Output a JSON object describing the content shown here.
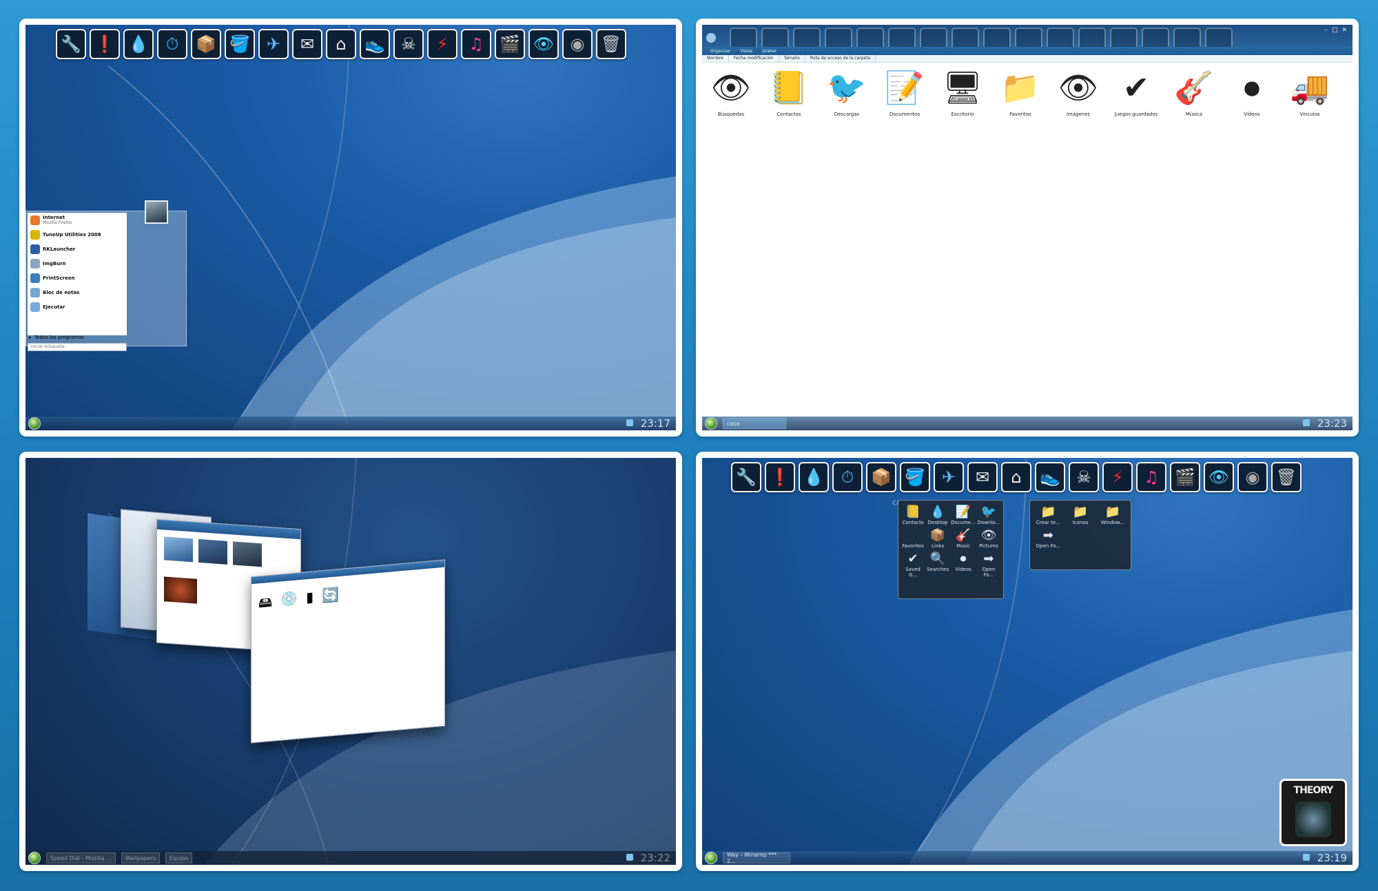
{
  "dock_icons": [
    "wrench-icon",
    "speech-bubble-icon",
    "drop-icon",
    "clock-icon",
    "box-icon",
    "paint-bucket-icon",
    "airplane-icon",
    "mail-icon",
    "home-icon",
    "runner-shoe-icon",
    "skull-icon",
    "lightning-icon",
    "music-note-icon",
    "clapperboard-icon",
    "eye-icon",
    "camera-lens-icon",
    "trash-icon"
  ],
  "panel1": {
    "clock": "23:17",
    "start_menu": {
      "items": [
        {
          "label": "Internet",
          "sub": "Mozilla Firefox",
          "icon": "firefox-icon"
        },
        {
          "label": "TuneUp Utilities 2008",
          "sub": "",
          "icon": "tuneup-icon"
        },
        {
          "label": "RKLauncher",
          "sub": "",
          "icon": "rklauncher-icon"
        },
        {
          "label": "ImgBurn",
          "sub": "",
          "icon": "imgburn-icon"
        },
        {
          "label": "PrintScreen",
          "sub": "",
          "icon": "printscreen-icon"
        },
        {
          "label": "Bloc de notas",
          "sub": "",
          "icon": "notepad-icon"
        },
        {
          "label": "Ejecutar",
          "sub": "",
          "icon": "run-icon"
        }
      ],
      "all_programs": "Todos los programas",
      "search_placeholder": "Iniciar búsqueda"
    }
  },
  "panel2": {
    "clock": "23:23",
    "toolbar": [
      "Organizar",
      "Vistas",
      "Grabar"
    ],
    "columns": [
      "Nombre",
      "Fecha modificación",
      "Tamaño",
      "Ruta de acceso de la carpeta"
    ],
    "folders": [
      {
        "label": "Búsquedas",
        "icon": "eyeball-icon"
      },
      {
        "label": "Contactos",
        "icon": "address-book-icon"
      },
      {
        "label": "Descargas",
        "icon": "bird-icon"
      },
      {
        "label": "Documentos",
        "icon": "pencil-paper-icon"
      },
      {
        "label": "Escritorio",
        "icon": "finder-icon"
      },
      {
        "label": "Favoritos",
        "icon": "apple-icon"
      },
      {
        "label": "Imágenes",
        "icon": "eye-icon"
      },
      {
        "label": "Juegos guardados",
        "icon": "checkmark-icon"
      },
      {
        "label": "Música",
        "icon": "guitar-icon"
      },
      {
        "label": "Vídeos",
        "icon": "quicktime-icon"
      },
      {
        "label": "Vínculos",
        "icon": "truck-icon"
      }
    ],
    "task": "casa"
  },
  "panel3": {
    "clock": "23:22",
    "tasks": [
      "Speed Dial - Mozilla ...",
      "Wallpapers",
      "Equipo"
    ]
  },
  "panel4": {
    "clock": "23:19",
    "fan_label": "casa",
    "fan1": [
      "Contacts",
      "Desktop",
      "Docume...",
      "Downlo...",
      "Favorites",
      "Links",
      "Music",
      "Pictures",
      "Saved G...",
      "Searches",
      "Videos",
      "Open Fo..."
    ],
    "fan2": [
      "Crear te...",
      "Iconos",
      "Window...",
      "Open Fo..."
    ],
    "album_text": "THEORY",
    "task": "Way - Winamp *** 2..."
  }
}
